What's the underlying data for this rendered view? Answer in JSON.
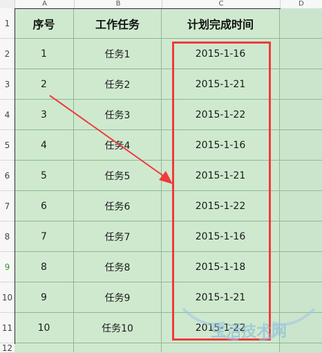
{
  "column_headers": [
    "A",
    "B",
    "C",
    "D"
  ],
  "row_numbers": [
    "1",
    "2",
    "3",
    "4",
    "5",
    "6",
    "7",
    "8",
    "9",
    "10",
    "11",
    "12"
  ],
  "selected_row": "9",
  "table": {
    "headers": [
      "序号",
      "工作任务",
      "计划完成时间"
    ],
    "rows": [
      {
        "no": "1",
        "task": "任务1",
        "date": "2015-1-16"
      },
      {
        "no": "2",
        "task": "任务2",
        "date": "2015-1-21"
      },
      {
        "no": "3",
        "task": "任务3",
        "date": "2015-1-22"
      },
      {
        "no": "4",
        "task": "任务4",
        "date": "2015-1-16"
      },
      {
        "no": "5",
        "task": "任务5",
        "date": "2015-1-21"
      },
      {
        "no": "6",
        "task": "任务6",
        "date": "2015-1-22"
      },
      {
        "no": "7",
        "task": "任务7",
        "date": "2015-1-16"
      },
      {
        "no": "8",
        "task": "任务8",
        "date": "2015-1-18"
      },
      {
        "no": "9",
        "task": "任务9",
        "date": "2015-1-21"
      },
      {
        "no": "10",
        "task": "任务10",
        "date": "2015-1-22"
      }
    ]
  },
  "annotation": {
    "highlight_color": "#ef3b3b",
    "arrow_color": "#ef3b3b"
  },
  "watermark": {
    "text": "生活技术网"
  },
  "colors": {
    "cell_fill": "#cfe9cf",
    "grid_line": "#8fb596",
    "selected_row_number": "#3a8f3a"
  }
}
